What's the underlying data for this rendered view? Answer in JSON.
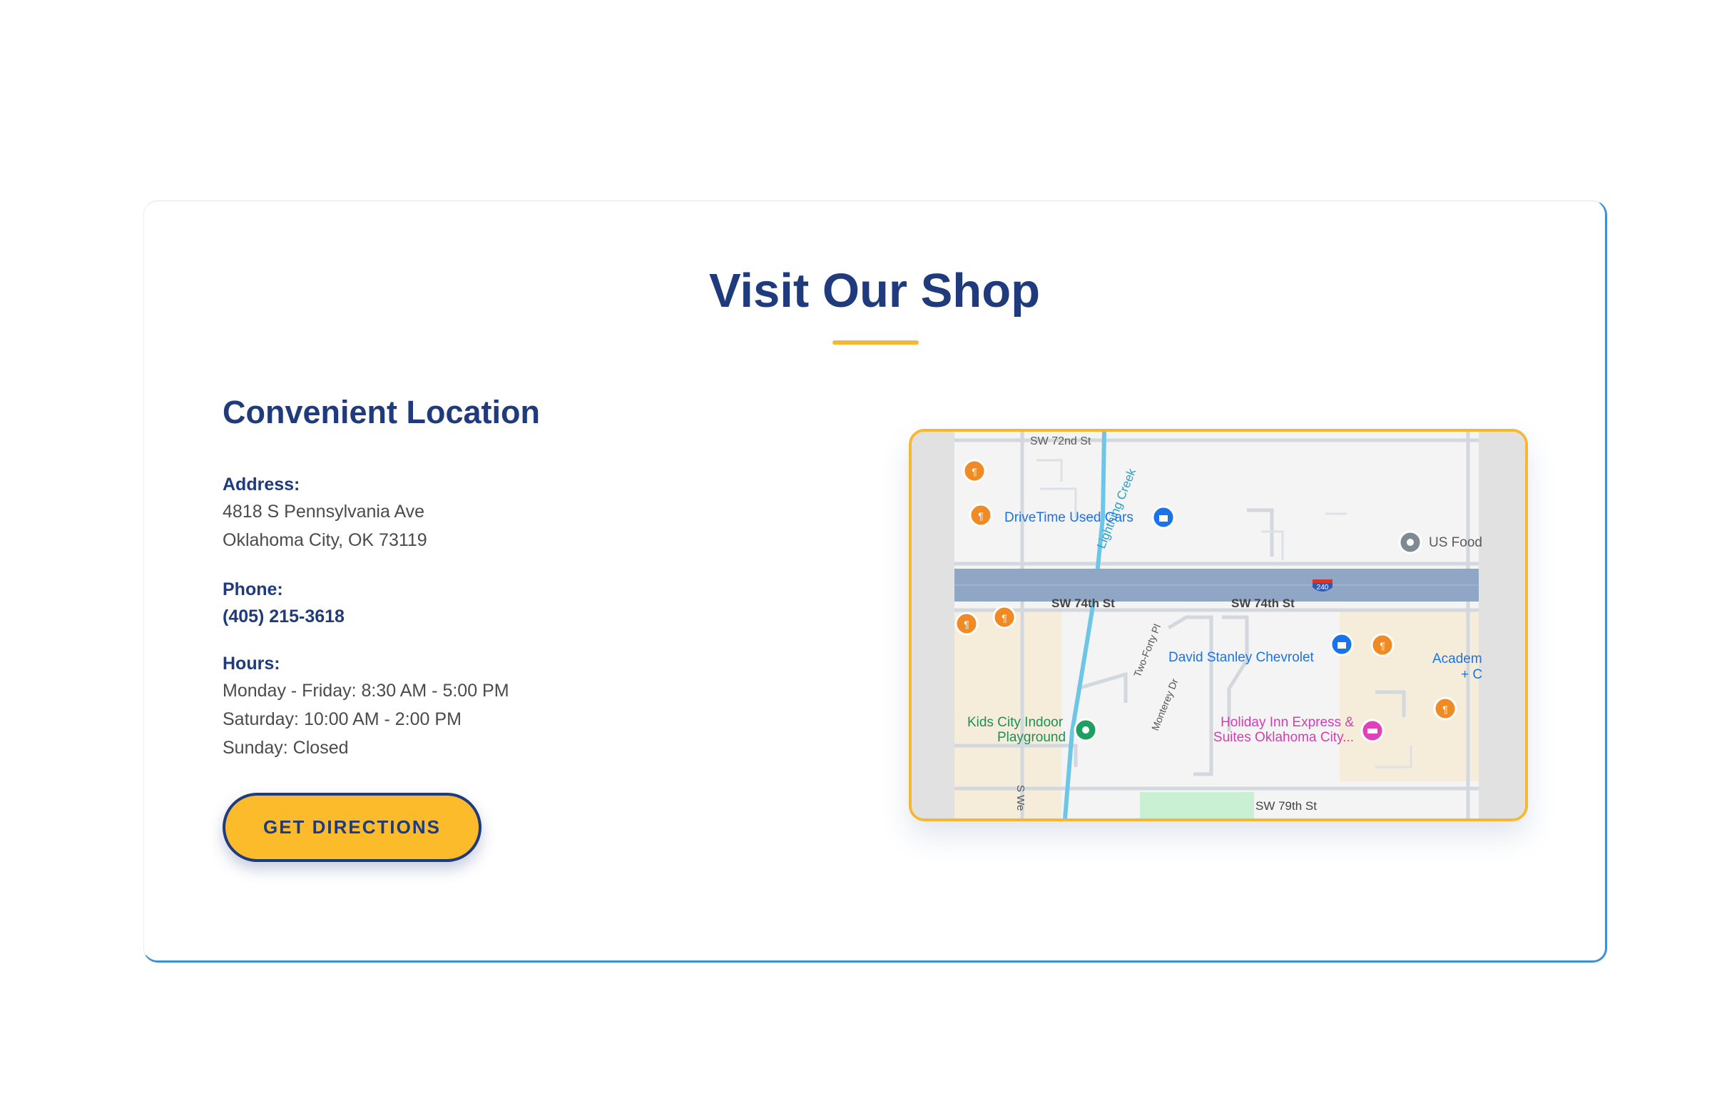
{
  "section": {
    "title": "Visit Our Shop"
  },
  "location": {
    "heading": "Convenient Location",
    "address_label": "Address:",
    "address_line1": "4818 S Pennsylvania Ave",
    "address_line2": "Oklahoma City, OK 73119",
    "phone_label": "Phone:",
    "phone": "(405) 215-3618",
    "hours_label": "Hours:",
    "hours": [
      "Monday - Friday: 8:30 AM - 5:00 PM",
      "Saturday: 10:00 AM - 2:00 PM",
      "Sunday: Closed"
    ],
    "directions_button": "GET DIRECTIONS"
  },
  "map": {
    "streets": {
      "sw72": "SW 72nd St",
      "sw74_a": "SW 74th St",
      "sw74_b": "SW 74th St",
      "sw79": "SW 79th St",
      "s_west": "S We",
      "two_forty": "Two-Forty Pl",
      "monterey": "Monterey Dr",
      "creek": "Lightning Creek",
      "interstate": "240"
    },
    "places": {
      "drivetime": "DriveTime Used Cars",
      "us_food": "US Food",
      "chevrolet": "David Stanley Chevrolet",
      "academy_1": "Academ",
      "academy_2": "+ C",
      "kids_city_1": "Kids City Indoor",
      "kids_city_2": "Playground",
      "holiday_1": "Holiday Inn Express &",
      "holiday_2": "Suites Oklahoma City..."
    },
    "colors": {
      "frame": "#f5b830",
      "highway": "#8fa6c4",
      "restaurant_pin": "#f08a24",
      "shopping_pin": "#1a73e8",
      "hotel_pin": "#e040b8",
      "park_pin": "#1e9e60",
      "water": "#6ec6e6",
      "land": "#f5edd9"
    },
    "icons": [
      "restaurant-icon",
      "shopping-bag-icon",
      "hotel-icon",
      "park-icon",
      "place-icon"
    ]
  },
  "theme": {
    "primary": "#1f3b7d",
    "accent": "#fbbb2b",
    "card_border": "#3f8fd8"
  }
}
